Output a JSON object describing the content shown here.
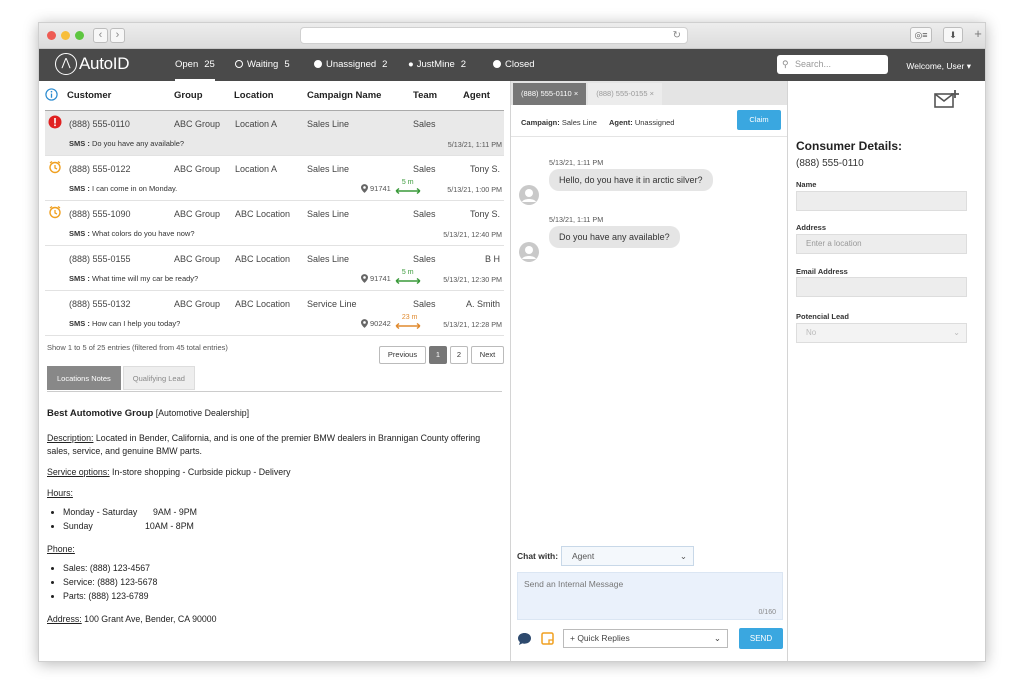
{
  "browser": {
    "url_icon": "reload-icon"
  },
  "app": {
    "logo": "AutoID"
  },
  "nav": {
    "tabs": [
      {
        "label": "Open",
        "count": "25"
      },
      {
        "label": "Waiting",
        "count": "5"
      },
      {
        "label": "Unassigned",
        "count": "2"
      },
      {
        "label": "JustMine",
        "count": "2"
      },
      {
        "label": "Closed",
        "count": ""
      }
    ],
    "search_placeholder": "Search...",
    "welcome": "Welcome, User"
  },
  "table": {
    "headers": [
      "Customer",
      "Group",
      "Location",
      "Campaign Name",
      "Team",
      "Agent"
    ],
    "rows": [
      {
        "phone": "(888) 555-0110",
        "group": "ABC Group",
        "location": "Location A",
        "campaign": "Sales Line",
        "team": "Sales",
        "agent": "",
        "sms_label": "SMS :",
        "sms": "Do you have any available?",
        "date": "5/13/21, 1:11 PM",
        "zip": "",
        "dist": "",
        "status": "alert",
        "dist_color": ""
      },
      {
        "phone": "(888) 555-0122",
        "group": "ABC Group",
        "location": "Location A",
        "campaign": "Sales Line",
        "team": "Sales",
        "agent": "Tony S.",
        "sms_label": "SMS :",
        "sms": "I can come in on Monday.",
        "date": "5/13/21, 1:00 PM",
        "zip": "91741",
        "dist": "5 m",
        "status": "clock",
        "dist_color": "#3a9a3a"
      },
      {
        "phone": "(888) 555-1090",
        "group": "ABC Group",
        "location": "ABC Location",
        "campaign": "Sales Line",
        "team": "Sales",
        "agent": "Tony S.",
        "sms_label": "SMS :",
        "sms": "What colors do you have now?",
        "date": "5/13/21, 12:40 PM",
        "zip": "",
        "dist": "",
        "status": "clock",
        "dist_color": ""
      },
      {
        "phone": "(888) 555-0155",
        "group": "ABC Group",
        "location": "ABC Location",
        "campaign": "Sales Line",
        "team": "Sales",
        "agent": "B H",
        "sms_label": "SMS :",
        "sms": "What time will my car be ready?",
        "date": "5/13/21, 12:30 PM",
        "zip": "91741",
        "dist": "5 m",
        "status": "",
        "dist_color": "#3a9a3a"
      },
      {
        "phone": "(888) 555-0132",
        "group": "ABC Group",
        "location": "ABC Location",
        "campaign": "Service Line",
        "team": "Sales",
        "agent": "A. Smith",
        "sms_label": "SMS :",
        "sms": "How can I help you today?",
        "date": "5/13/21, 12:28 PM",
        "zip": "90242",
        "dist": "23 m",
        "status": "",
        "dist_color": "#e08a2e"
      }
    ],
    "footer": "Show 1 to 5 of 25 entries (filtered from 45 total entries)",
    "pagination": {
      "prev": "Previous",
      "pages": [
        "1",
        "2"
      ],
      "next": "Next"
    }
  },
  "subtabs": [
    "Locations Notes",
    "Qualifying Lead"
  ],
  "notes": {
    "title": "Best Automotive Group",
    "title_suffix": "[Automotive Dealership]",
    "description_label": "Description:",
    "description": "Located in Bender, California, and is one of the premier BMW dealers in Brannigan County offering sales, service, and genuine BMW parts.",
    "service_label": "Service options:",
    "service": "In-store shopping - Curbside pickup - Delivery",
    "hours_label": "Hours:",
    "hours": [
      {
        "days": "Monday - Saturday",
        "time": "9AM - 9PM"
      },
      {
        "days": "Sunday",
        "time": "10AM - 8PM"
      }
    ],
    "phone_label": "Phone:",
    "phones": [
      "Sales: (888) 123-4567",
      "Service: (888) 123-5678",
      "Parts: (888) 123-6789"
    ],
    "address_label": "Address:",
    "address": "100 Grant Ave, Bender, CA 90000"
  },
  "chat": {
    "tabs": [
      "(888) 555-0110",
      "(888) 555-0155"
    ],
    "campaign_label": "Campaign:",
    "campaign": "Sales Line",
    "agent_label": "Agent:",
    "agent": "Unassigned",
    "claim": "Claim",
    "messages": [
      {
        "time": "5/13/21, 1:11 PM",
        "text": "Hello,  do you have it in arctic silver?"
      },
      {
        "time": "5/13/21, 1:11 PM",
        "text": "Do you have any available?"
      }
    ],
    "chat_with_label": "Chat with:",
    "chat_with": "Agent",
    "message_placeholder": "Send an Internal Message",
    "counter": "0/160",
    "quick_replies": "+ Quick Replies",
    "send": "SEND"
  },
  "consumer": {
    "title": "Consumer Details:",
    "phone": "(888) 555-0110",
    "name_label": "Name",
    "address_label": "Address",
    "address_placeholder": "Enter a location",
    "email_label": "Email Address",
    "lead_label": "Potencial Lead",
    "lead_value": "No"
  },
  "colors": {
    "accent": "#3aa7e0",
    "header": "#4a4a4a",
    "alert": "#e02020",
    "clock": "#f0a020"
  }
}
